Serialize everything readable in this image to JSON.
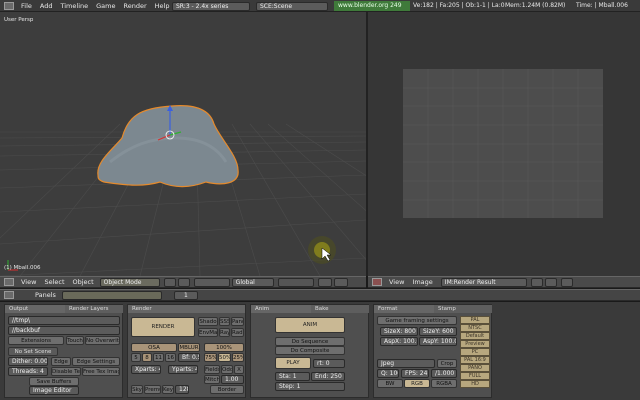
{
  "menubar": {
    "items": [
      "File",
      "Add",
      "Timeline",
      "Game",
      "Render",
      "Help"
    ],
    "screen": "SR:3 - 2.4x series",
    "scene": "SCE:Scene",
    "url": "www.blender.org 249",
    "stats": "Ve:182 | Fa:205 | Ob:1-1 | La:0",
    "mem": "Mem:1.24M (0.82M)",
    "time": "Time: | Mball.006"
  },
  "viewport": {
    "label": "User Persp",
    "object_label": "(1) Mball.006",
    "header": {
      "menus": [
        "View",
        "Select",
        "Object"
      ],
      "mode": "Object Mode",
      "orientation": "Global"
    }
  },
  "image_editor": {
    "header": {
      "menus": [
        "View",
        "Image"
      ],
      "image_name": "IM:Render Result"
    }
  },
  "buttons_header": {
    "panels_label": "Panels",
    "frame": "1"
  },
  "output_panel": {
    "tabs": [
      "Output",
      "Render Layers"
    ],
    "path1": "//tmp\\",
    "path2": "//backbuf",
    "extensions": "Extensions",
    "touch": "Touch",
    "no_overwrite": "No Overwrite",
    "no_set_scene": "No Set Scene",
    "dither": "Dither: 0.000",
    "edge": "Edge",
    "edge_settings": "Edge Settings",
    "threads": "Threads: 4",
    "disable_tex": "Disable Tex",
    "free_tex": "Free Tex Images",
    "save_buffers": "Save Buffers",
    "image_editor": "Image Editor"
  },
  "render_panel": {
    "tab": "Render",
    "render_button": "RENDER",
    "shadow": "Shado",
    "env": "EnvMap",
    "pano": "Pano",
    "ray": "Ray",
    "radio": "Radio",
    "osa": "OSA",
    "mblur": "MBLUR",
    "osa_levels": [
      "5",
      "8",
      "11",
      "16"
    ],
    "bf": "Bf: 0.50",
    "percent": "100%",
    "pct_levels": [
      "75%",
      "50%",
      "25%"
    ],
    "xparts": "Xparts: 4",
    "yparts": "Yparts: 4",
    "fields": "Fields",
    "odd": "Odd",
    "x": "X",
    "mitch": "Mitch",
    "mitch_value": "1.00",
    "sky": "Sky",
    "premul": "Premul",
    "key": "Key",
    "key_value": "128",
    "border": "Border"
  },
  "anim_panel": {
    "tabs": [
      "Anim",
      "Bake"
    ],
    "anim_button": "ANIM",
    "do_sequence": "Do Sequence",
    "do_composite": "Do Composite",
    "play": "PLAY",
    "rt": "rt: 0",
    "sta": "Sta: 1",
    "end": "End: 250",
    "step": "Step: 1"
  },
  "format_panel": {
    "tabs": [
      "Format",
      "Stamp"
    ],
    "game_framing": "Game framing settings",
    "sizex": "SizeX: 800",
    "sizey": "SizeY: 600",
    "aspx": "AspX: 100.00",
    "aspy": "AspY: 100.00",
    "image_format": "Jpeg",
    "crop": "Crop",
    "quality": "Q: 100",
    "fps": "FPS: 24",
    "fps_base": "/1.000",
    "bw": "BW",
    "rgb": "RGB",
    "rgba": "RGBA",
    "presets": [
      "PAL",
      "NTSC",
      "Default",
      "Preview",
      "PC",
      "PAL 16:9",
      "PANO",
      "FULL",
      "HD"
    ]
  },
  "colors": {
    "accent_orange": "#e58a2c",
    "button_tan": "#c9b894",
    "url_green": "#3f7a3a"
  }
}
